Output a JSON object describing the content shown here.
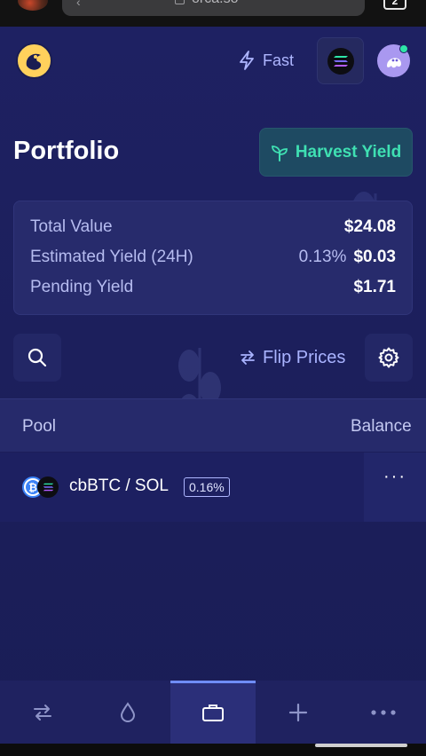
{
  "browser": {
    "url": "orca.so",
    "tab_count": "2"
  },
  "header": {
    "speed_label": "Fast",
    "network_icon": "solana-icon",
    "wallet_icon": "wallet-avatar-icon"
  },
  "page": {
    "title": "Portfolio",
    "harvest_label": "Harvest Yield"
  },
  "summary": {
    "total_value_label": "Total Value",
    "total_value": "$24.08",
    "est_yield_label": "Estimated Yield (24H)",
    "est_yield_pct": "0.13%",
    "est_yield_value": "$0.03",
    "pending_yield_label": "Pending Yield",
    "pending_yield_value": "$1.71"
  },
  "toolbar": {
    "flip_label": "Flip Prices"
  },
  "table": {
    "columns": [
      "Pool",
      "Balance"
    ],
    "rows": [
      {
        "pair": "cbBTC / SOL",
        "fee": "0.16%",
        "more": "···"
      }
    ]
  },
  "colors": {
    "background": "#1c1f5c",
    "card": "#272b6c",
    "accent_green": "#3fe0b2",
    "accent_blue": "#a9b3ff",
    "active_nav": "#6f8dff"
  },
  "nav": {
    "items": [
      "swap-icon",
      "liquidity-drop-icon",
      "portfolio-briefcase-icon",
      "add-plus-icon",
      "more-icon"
    ],
    "active": "portfolio-briefcase-icon"
  }
}
